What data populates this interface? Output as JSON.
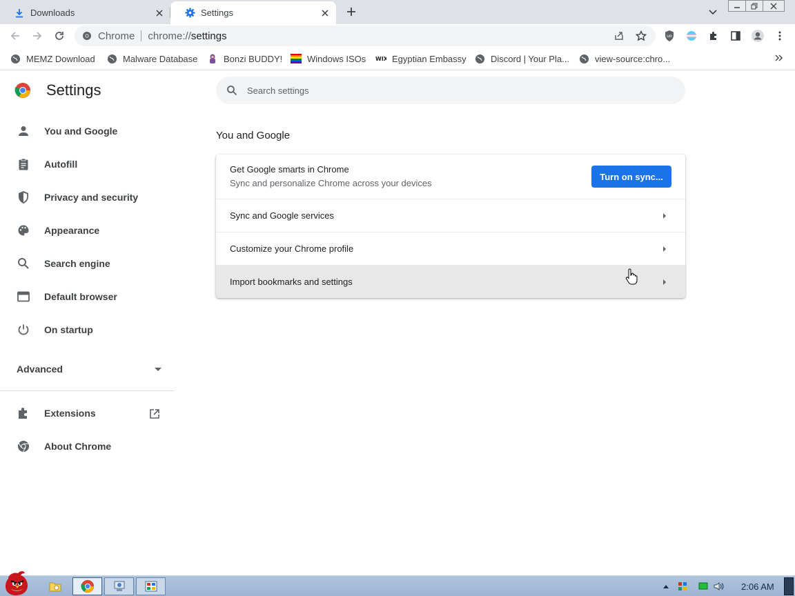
{
  "colors": {
    "accent": "#1a73e8",
    "tab_strip": "#dee1e6",
    "omnibox": "#f1f3f4",
    "hover_row": "#e8e8e8",
    "taskbar": "#aec4dd"
  },
  "tabs": [
    {
      "title": "Downloads",
      "icon": "download-icon"
    },
    {
      "title": "Settings",
      "icon": "settings-gear-icon"
    }
  ],
  "omnibox": {
    "chip": "Chrome",
    "url_scheme": "chrome://",
    "url_path": "settings"
  },
  "bookmarks": [
    {
      "label": "MEMZ Download",
      "icon": "globe-icon"
    },
    {
      "label": "Malware Database",
      "icon": "globe-icon"
    },
    {
      "label": "Bonzi BUDDY!",
      "icon": "bonzi-icon"
    },
    {
      "label": "Windows ISOs",
      "icon": "rainbow-flag-icon"
    },
    {
      "label": "Egyptian Embassy",
      "icon": "wix-icon"
    },
    {
      "label": "Discord | Your Pla...",
      "icon": "globe-icon"
    },
    {
      "label": "view-source:chro...",
      "icon": "globe-icon"
    }
  ],
  "settings": {
    "title": "Settings",
    "search_placeholder": "Search settings",
    "sidebar": [
      {
        "label": "You and Google",
        "icon": "person-icon"
      },
      {
        "label": "Autofill",
        "icon": "clipboard-icon"
      },
      {
        "label": "Privacy and security",
        "icon": "shield-icon"
      },
      {
        "label": "Appearance",
        "icon": "palette-icon"
      },
      {
        "label": "Search engine",
        "icon": "search-icon"
      },
      {
        "label": "Default browser",
        "icon": "browser-window-icon"
      },
      {
        "label": "On startup",
        "icon": "power-icon"
      }
    ],
    "advanced_label": "Advanced",
    "extensions_label": "Extensions",
    "about_label": "About Chrome",
    "section_title": "You and Google",
    "sync_card": {
      "title": "Get Google smarts in Chrome",
      "subtitle": "Sync and personalize Chrome across your devices",
      "button": "Turn on sync..."
    },
    "rows": [
      {
        "label": "Sync and Google services"
      },
      {
        "label": "Customize your Chrome profile"
      },
      {
        "label": "Import bookmarks and settings"
      }
    ]
  },
  "taskbar": {
    "clock": "2:06 AM"
  }
}
